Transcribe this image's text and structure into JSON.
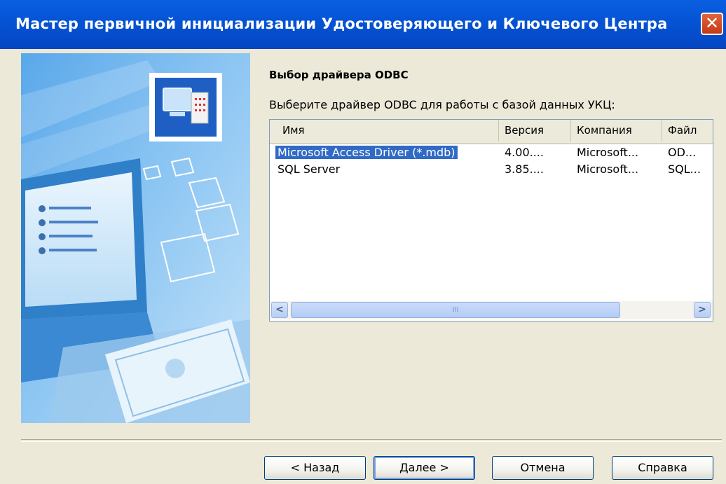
{
  "window": {
    "title": "Мастер первичной инициализации Удостоверяющего и Ключевого Центра",
    "close_glyph": "✕"
  },
  "page": {
    "heading": "Выбор драйвера ODBC",
    "instruction": "Выберите драйвер ODBC для работы с базой данных УКЦ:"
  },
  "driver_list": {
    "columns": [
      "Имя",
      "Версия",
      "Компания",
      "Файл"
    ],
    "rows": [
      {
        "name": "Microsoft Access Driver (*.mdb)",
        "version": "4.00....",
        "company": "Microsoft...",
        "file": "OD...",
        "selected": true
      },
      {
        "name": "SQL Server",
        "version": "3.85....",
        "company": "Microsoft...",
        "file": "SQL...",
        "selected": false
      }
    ],
    "scroll_left": "<",
    "scroll_right": ">",
    "scroll_grip": "III"
  },
  "buttons": {
    "back": "< Назад",
    "next": "Далее >",
    "cancel": "Отмена",
    "help": "Справка"
  },
  "colors": {
    "title_bar": "#0554d6",
    "selection": "#316ac5",
    "panel_blue": "#3c8fe0"
  },
  "icons": {
    "wizard_badge": "computer-with-server-icon",
    "side_folders": "folder-icon"
  }
}
